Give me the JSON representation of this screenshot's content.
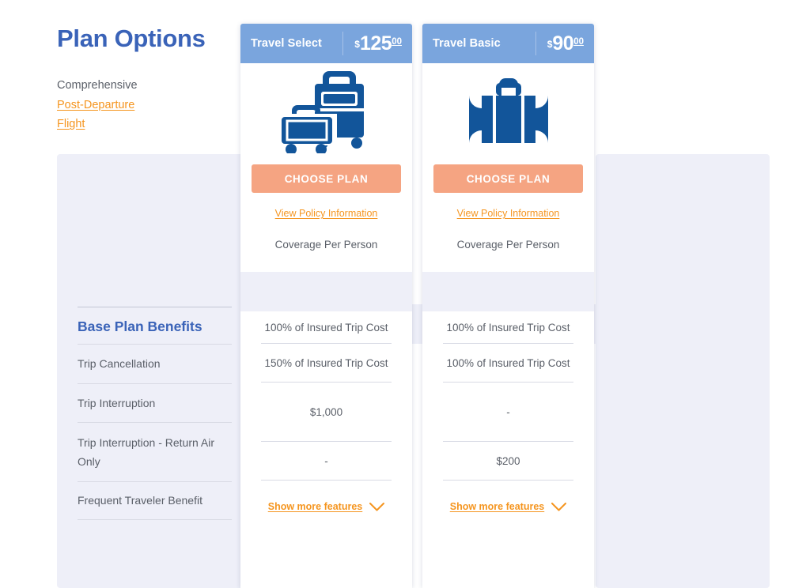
{
  "page": {
    "title": "Plan Options",
    "plan_types": [
      {
        "label": "Comprehensive",
        "is_link": false
      },
      {
        "label": "Post-Departure",
        "is_link": true
      },
      {
        "label": "Flight",
        "is_link": true
      }
    ]
  },
  "benefits_section": {
    "heading": "Base Plan Benefits",
    "rows": [
      {
        "label": "Trip Cancellation"
      },
      {
        "label": "Trip Interruption"
      },
      {
        "label": "Trip Interruption - Return Air Only"
      },
      {
        "label": "Frequent Traveler Benefit"
      }
    ]
  },
  "plans": [
    {
      "name": "Travel Select",
      "currency_symbol": "$",
      "price_whole": "125",
      "price_cents": "00",
      "icon": "two-suitcases-icon",
      "choose_label": "CHOOSE PLAN",
      "policy_link": "View Policy Information",
      "coverage_label": "Coverage Per Person",
      "values": [
        "100% of Insured Trip Cost",
        "150% of Insured Trip Cost",
        "$1,000",
        "-"
      ],
      "show_more_label": "Show more features"
    },
    {
      "name": "Travel Basic",
      "currency_symbol": "$",
      "price_whole": "90",
      "price_cents": "00",
      "icon": "single-suitcase-icon",
      "choose_label": "CHOOSE PLAN",
      "policy_link": "View Policy Information",
      "coverage_label": "Coverage Per Person",
      "values": [
        "100% of Insured Trip Cost",
        "100% of Insured Trip Cost",
        "-",
        "$200"
      ],
      "show_more_label": "Show more features"
    }
  ],
  "colors": {
    "title_blue": "#3a63b8",
    "header_blue": "#7aa5dd",
    "button_peach": "#f5a482",
    "link_orange": "#f5951f",
    "panel_lavender": "#eeeff8",
    "icon_navy": "#12559a",
    "body_gray": "#5a5f68"
  }
}
